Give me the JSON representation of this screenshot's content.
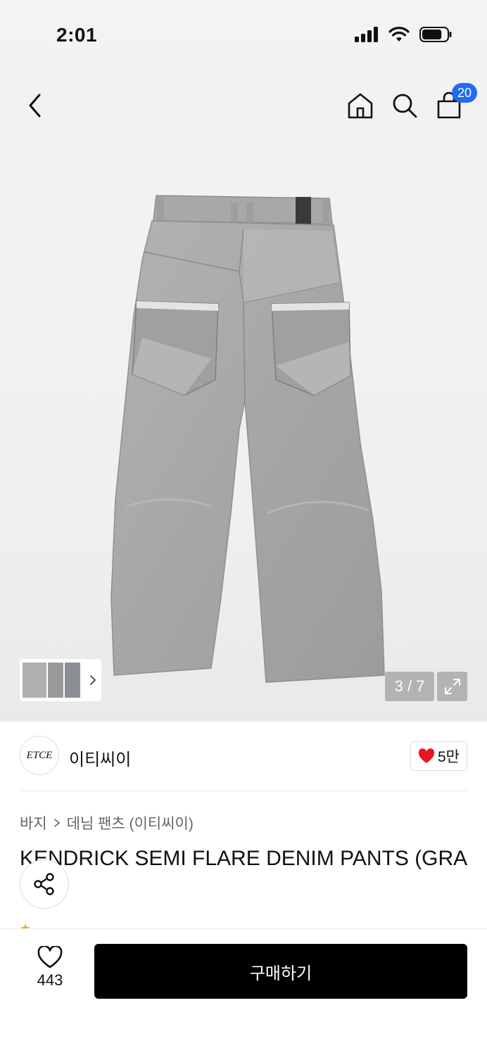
{
  "status_bar": {
    "time": "2:01",
    "battery_level": 0.8
  },
  "nav": {
    "back_icon": "chevron-left-icon",
    "home_icon": "home-icon",
    "search_icon": "search-icon",
    "cart_icon": "shopping-bag-icon",
    "cart_count": "20",
    "badge_color": "#1f6bf2"
  },
  "gallery": {
    "counter": "3 / 7",
    "current_index": 3,
    "total": 7,
    "expand_icon": "expand-icon"
  },
  "brand": {
    "logo_text": "ETCE",
    "name": "이티씨이",
    "likes": "5만"
  },
  "breadcrumb": {
    "level1": "바지",
    "level2": "데님 팬츠 (이티씨이)"
  },
  "product": {
    "title": "KENDRICK SEMI FLARE DENIM PANTS (GRA"
  },
  "bottom_bar": {
    "wishlist_count": "443",
    "buy_label": "구매하기"
  }
}
